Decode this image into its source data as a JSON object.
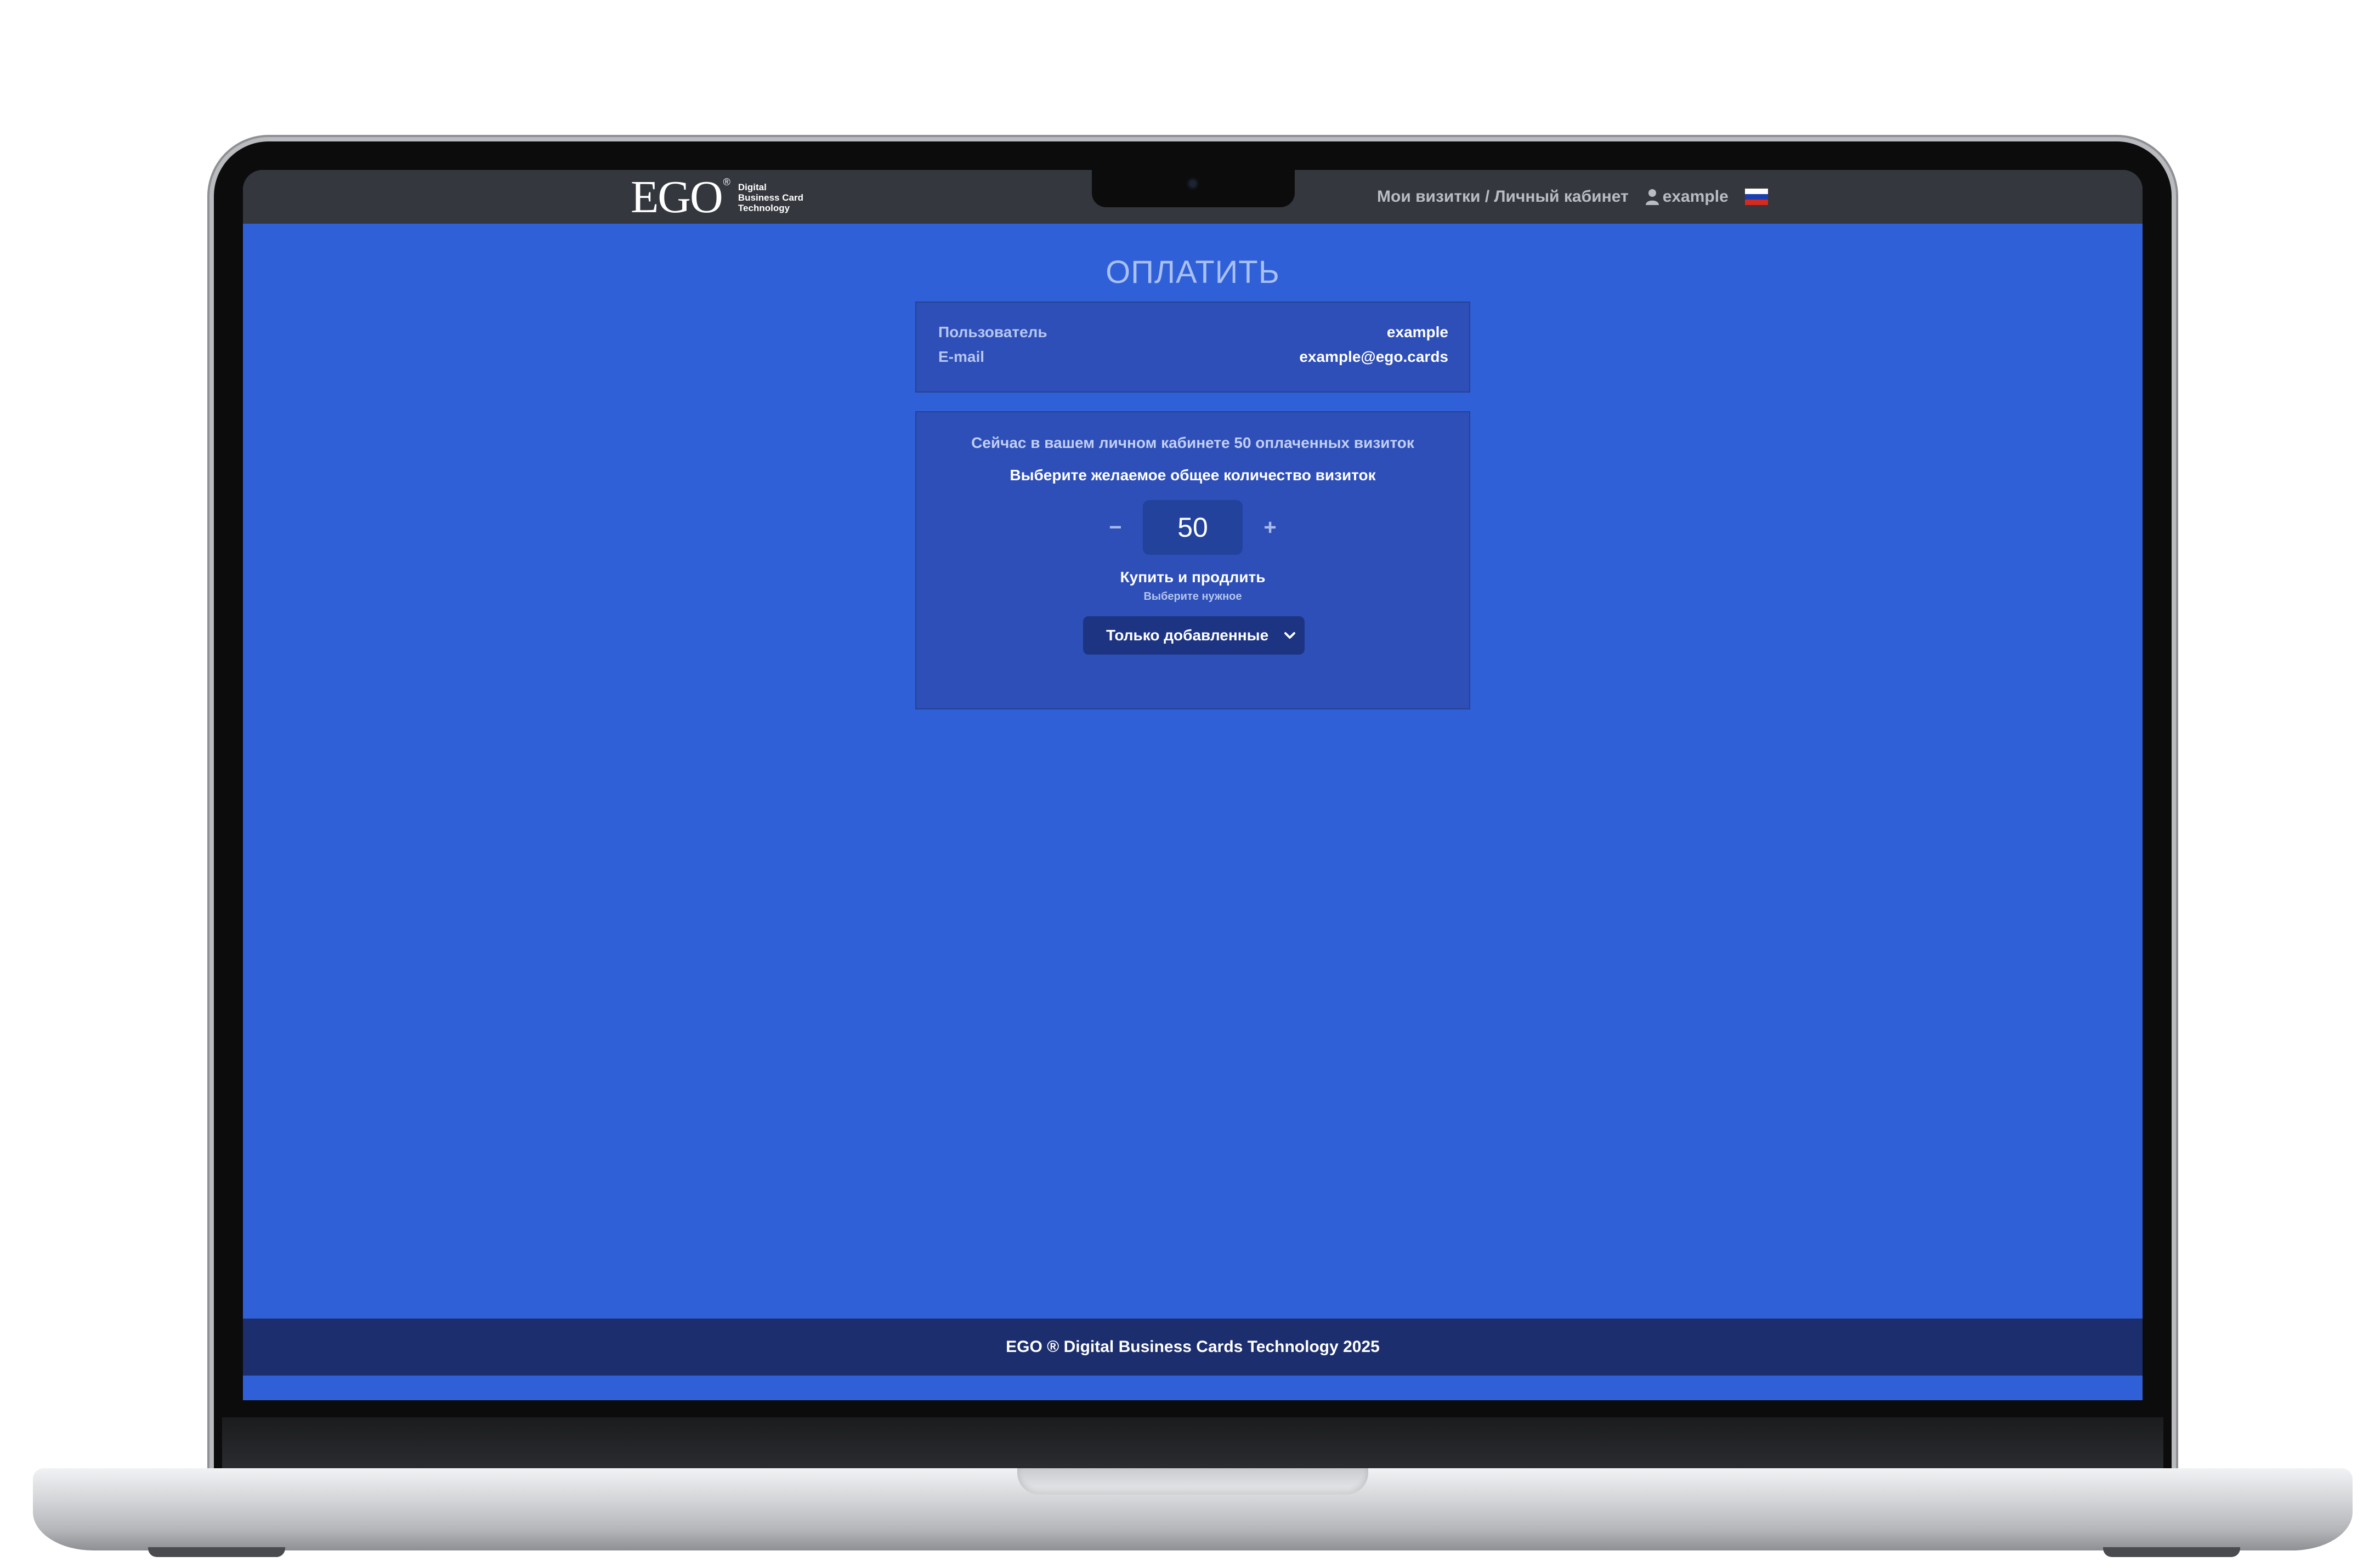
{
  "navbar": {
    "logo_main": "EGO",
    "logo_reg": "®",
    "logo_sub_1": "Digital",
    "logo_sub_2": "Business Card",
    "logo_sub_3": "Technology",
    "nav_link": "Мои визитки / Личный кабинет",
    "username": "example",
    "language_flag": "ru-flag-icon"
  },
  "page": {
    "title": "ОПЛАТИТЬ"
  },
  "info": {
    "user_label": "Пользователь",
    "user_value": "example",
    "email_label": "E-mail",
    "email_value": "example@ego.cards"
  },
  "purchase": {
    "current_text": "Сейчас в вашем личном кабинете 50 оплаченных визиток",
    "choose_text": "Выберите желаемое общее количество визиток",
    "minus": "−",
    "quantity": "50",
    "plus": "+",
    "buy_label": "Купить и продлить",
    "buy_hint": "Выберите нужное",
    "select_value": "Только добавленные"
  },
  "footer": {
    "text": "EGO ® Digital Business Cards Technology 2025"
  },
  "colors": {
    "page_bg": "#3060d8",
    "navbar_bg": "#34373d",
    "card_bg": "#2e4fb8",
    "footer_bg": "#1c2e6e"
  }
}
